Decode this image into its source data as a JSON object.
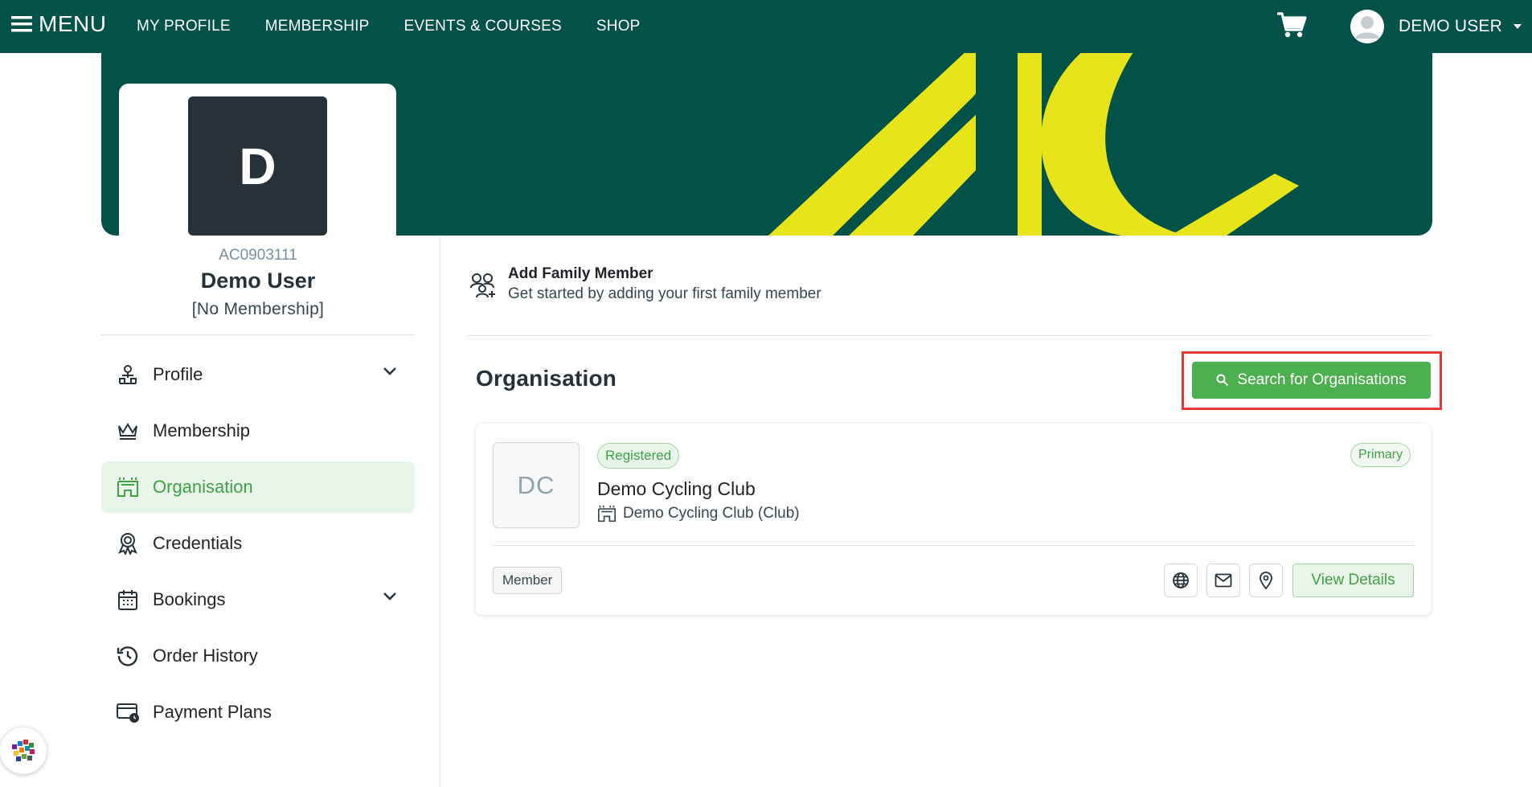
{
  "topnav": {
    "menu_label": "MENU",
    "links": [
      "MY PROFILE",
      "MEMBERSHIP",
      "EVENTS & COURSES",
      "SHOP"
    ],
    "user_name": "DEMO USER"
  },
  "profile": {
    "avatar_initial": "D",
    "member_id": "AC0903111",
    "name": "Demo User",
    "status": "[No Membership]"
  },
  "sidebar": {
    "items": [
      {
        "label": "Profile",
        "icon": "user-profile-icon",
        "expandable": true
      },
      {
        "label": "Membership",
        "icon": "crown-icon",
        "expandable": false
      },
      {
        "label": "Organisation",
        "icon": "organisation-icon",
        "expandable": false,
        "active": true
      },
      {
        "label": "Credentials",
        "icon": "award-icon",
        "expandable": false
      },
      {
        "label": "Bookings",
        "icon": "calendar-icon",
        "expandable": true
      },
      {
        "label": "Order History",
        "icon": "history-icon",
        "expandable": false
      },
      {
        "label": "Payment Plans",
        "icon": "payment-card-icon",
        "expandable": false
      }
    ]
  },
  "family": {
    "title": "Add Family Member",
    "subtitle": "Get started by adding your first family member"
  },
  "organisation": {
    "heading": "Organisation",
    "search_button": "Search for Organisations",
    "card": {
      "logo_initials": "DC",
      "status_badge": "Registered",
      "primary_badge": "Primary",
      "name": "Demo Cycling Club",
      "type_line": "Demo Cycling Club (Club)",
      "role_tag": "Member",
      "view_button": "View Details"
    }
  },
  "colors": {
    "nav_bg": "#02524a",
    "accent_green": "#4caf50",
    "banner_yellow": "#e8e41a",
    "highlight_red": "#e53935"
  }
}
